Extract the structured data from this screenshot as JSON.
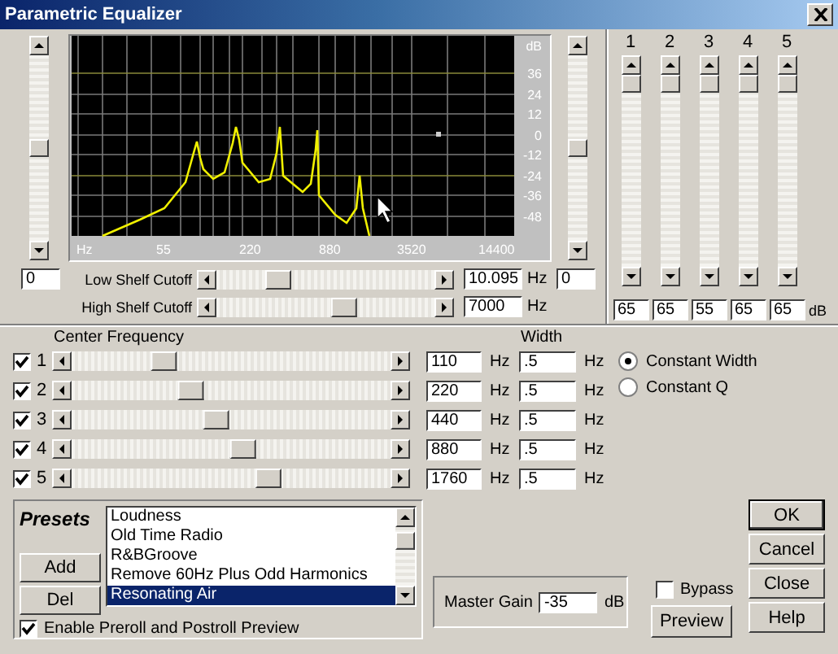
{
  "window": {
    "title": "Parametric Equalizer"
  },
  "graph": {
    "y_unit": "dB",
    "y_labels": [
      "36",
      "24",
      "12",
      "0",
      "-12",
      "-24",
      "-36",
      "-48"
    ],
    "x_labels": [
      "Hz",
      "55",
      "220",
      "880",
      "3520",
      "14400"
    ]
  },
  "left_gain": {
    "level": 0.5,
    "value": "0"
  },
  "right_gain": {
    "level": 0.5,
    "value": "0"
  },
  "shelves": [
    {
      "label": "Low Shelf Cutoff",
      "level": 0.25,
      "value": "10.095",
      "unit": "Hz"
    },
    {
      "label": "High Shelf Cutoff",
      "level": 0.6,
      "value": "7000",
      "unit": "Hz"
    }
  ],
  "band_gains": {
    "unit": "dB",
    "columns": [
      {
        "label": "1",
        "level": 1,
        "value": "65"
      },
      {
        "label": "2",
        "level": 1,
        "value": "65"
      },
      {
        "label": "3",
        "level": 1,
        "value": "55"
      },
      {
        "label": "4",
        "level": 1,
        "value": "65"
      },
      {
        "label": "5",
        "level": 1,
        "value": "65"
      }
    ]
  },
  "center_frequency": {
    "label": "Center Frequency",
    "width_label": "Width",
    "bands": [
      {
        "checked": true,
        "number": "1",
        "level": 0.27,
        "frequency": "110",
        "unit": "Hz",
        "width": ".5",
        "width_unit": "Hz"
      },
      {
        "checked": true,
        "number": "2",
        "level": 0.36,
        "frequency": "220",
        "unit": "Hz",
        "width": ".5",
        "width_unit": "Hz"
      },
      {
        "checked": true,
        "number": "3",
        "level": 0.45,
        "frequency": "440",
        "unit": "Hz",
        "width": ".5",
        "width_unit": "Hz"
      },
      {
        "checked": true,
        "number": "4",
        "level": 0.54,
        "frequency": "880",
        "unit": "Hz",
        "width": ".5",
        "width_unit": "Hz"
      },
      {
        "checked": true,
        "number": "5",
        "level": 0.63,
        "frequency": "1760",
        "unit": "Hz",
        "width": ".5",
        "width_unit": "Hz"
      }
    ]
  },
  "width_mode": [
    {
      "label": "Constant Width",
      "selected": true
    },
    {
      "label": "Constant Q",
      "selected": false
    }
  ],
  "presets": {
    "title": "Presets",
    "items": [
      {
        "label": "Loudness",
        "selected": false
      },
      {
        "label": "Old Time Radio",
        "selected": false
      },
      {
        "label": "R&BGroove",
        "selected": false
      },
      {
        "label": "Remove 60Hz Plus Odd Harmonics",
        "selected": false
      },
      {
        "label": "Resonating Air",
        "selected": true
      }
    ],
    "buttons": [
      "Add",
      "Del"
    ],
    "preview": {
      "label": "Enable Preroll and Postroll Preview",
      "checked": true
    }
  },
  "master_gain": {
    "label": "Master Gain",
    "value": "-35",
    "unit": "dB"
  },
  "bypass": {
    "label": "Bypass",
    "checked": false
  },
  "side_buttons": [
    "OK",
    "Cancel",
    "Close"
  ],
  "bottom_buttons": [
    "Preview",
    "Help"
  ]
}
